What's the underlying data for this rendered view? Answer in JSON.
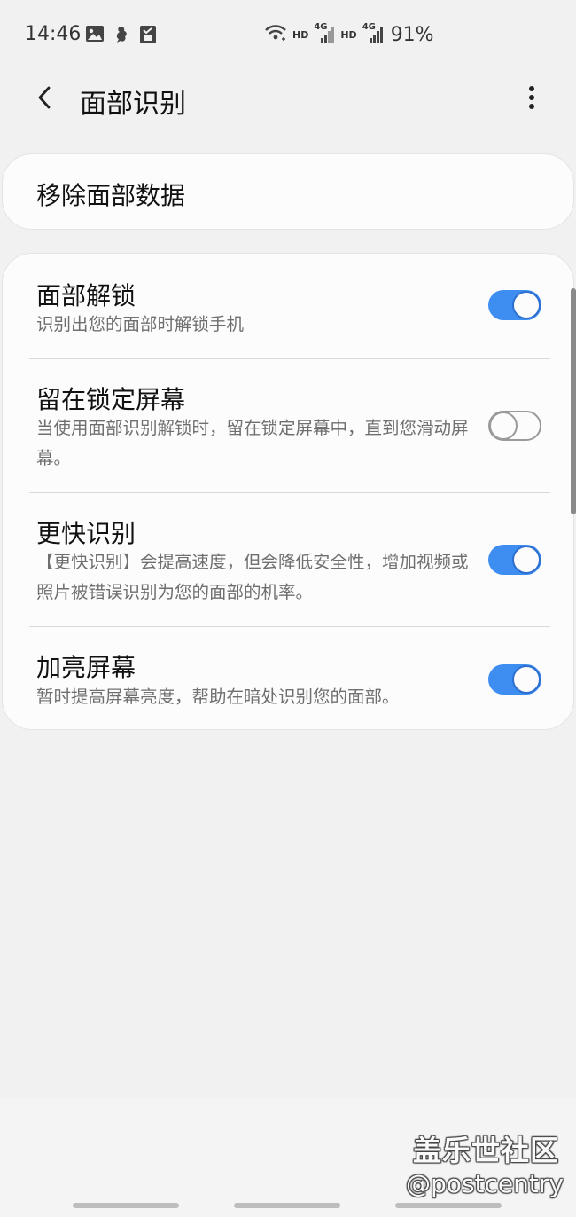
{
  "status_bar": {
    "time": "14:46",
    "left_icons": [
      "image-icon",
      "assistant-icon",
      "sim-card-icon"
    ],
    "network_label_1": "HD",
    "network_type_1": "4G",
    "network_label_2": "HD",
    "network_type_2": "4G",
    "battery": "91%"
  },
  "header": {
    "title": "面部识别",
    "back_icon": "chevron-left-icon",
    "more_icon": "more-vertical-icon"
  },
  "remove_card": {
    "label": "移除面部数据"
  },
  "settings": [
    {
      "title": "面部解锁",
      "description": "识别出您的面部时解锁手机",
      "enabled": true
    },
    {
      "title": "留在锁定屏幕",
      "description": "当使用面部识别解锁时，留在锁定屏幕中，直到您滑动屏幕。",
      "enabled": false
    },
    {
      "title": "更快识别",
      "description": "【更快识别】会提高速度，但会降低安全性，增加视频或照片被错误识别为您的面部的机率。",
      "enabled": true
    },
    {
      "title": "加亮屏幕",
      "description": "暂时提高屏幕亮度，帮助在暗处识别您的面部。",
      "enabled": true
    }
  ],
  "watermark": {
    "name": "盖乐世社区",
    "handle": "@postcentry"
  },
  "colors": {
    "background": "#f1f1f1",
    "card": "#fcfcfc",
    "toggle_on": "#3e8ef2",
    "secondary_text": "#6f6f6f"
  }
}
